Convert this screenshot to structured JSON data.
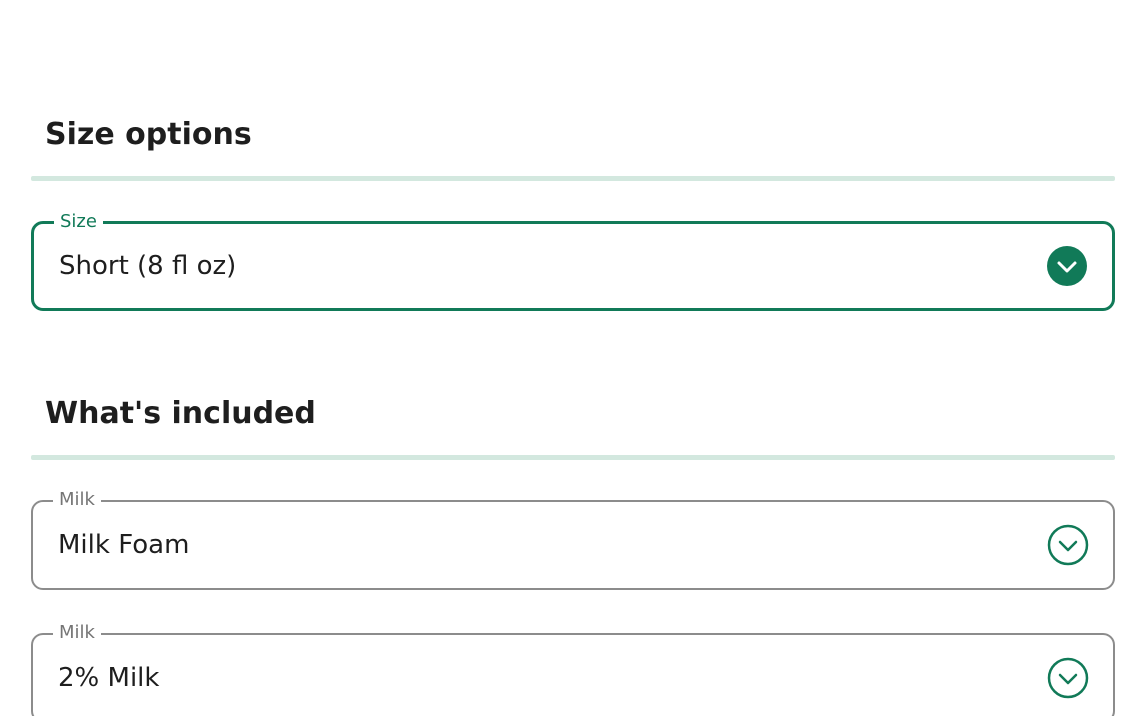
{
  "size_section": {
    "title": "Size options",
    "field": {
      "legend": "Size",
      "value": "Short (8 fl oz)",
      "icon": "check-circle-filled-icon"
    }
  },
  "included_section": {
    "title": "What's included",
    "fields": [
      {
        "legend": "Milk",
        "value": "Milk Foam",
        "icon": "chevron-down-circle-icon"
      },
      {
        "legend": "Milk",
        "value": "2% Milk",
        "icon": "chevron-down-circle-icon"
      }
    ]
  },
  "colors": {
    "accent": "#117a58",
    "divider": "#d3e8df",
    "border_neutral": "#8c8c8c"
  }
}
